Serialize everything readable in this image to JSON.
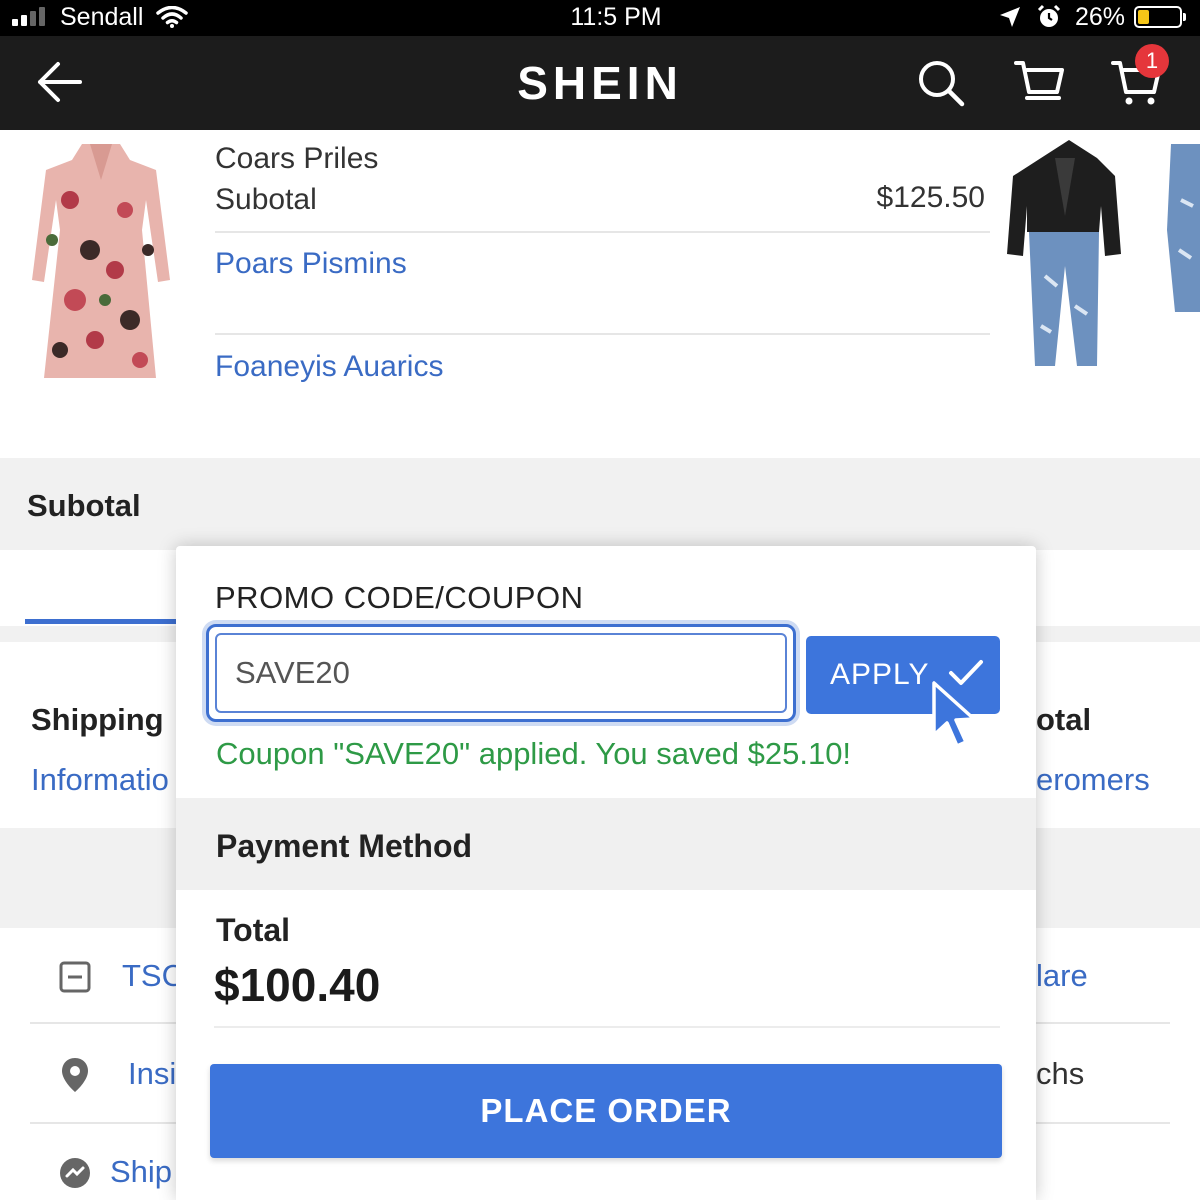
{
  "status_bar": {
    "carrier": "Sendall",
    "time": "11:5 PM",
    "battery": "26%",
    "battery_level": 0.26,
    "battery_color": "#f5c518"
  },
  "nav": {
    "logo": "SHEIN",
    "cart_badge": "1",
    "badge_color": "#e5363b",
    "icons": [
      "back-arrow-icon",
      "search-icon",
      "cart-icon",
      "cart-icon"
    ]
  },
  "cart": {
    "title": "Coars Priles",
    "subtotal_label": "Subotal",
    "subtotal_value": "$125.50",
    "link1": "Poars Pismins",
    "link2": "Foaneyis Auarics"
  },
  "summary": {
    "title": "Subotal"
  },
  "background": {
    "shipping": "Shipping",
    "information": "Informatio",
    "total_partial": "otal",
    "customers_partial": "eromers",
    "row1": "TSC",
    "row1_right": "lare",
    "row2": "Insi",
    "row2_right": "chs",
    "row3": "Ship"
  },
  "promo": {
    "label": "PROMO CODE/COUPON",
    "code": "SAVE20",
    "apply": "APPLY",
    "success": "Coupon \"SAVE20\" applied. You saved $25.10!",
    "success_color": "#2e9a46"
  },
  "payment": {
    "label": "Payment Method"
  },
  "order": {
    "total_label": "Total",
    "total_value": "$100.40",
    "place_order": "PLACE ORDER",
    "accent": "#3d75dc"
  }
}
